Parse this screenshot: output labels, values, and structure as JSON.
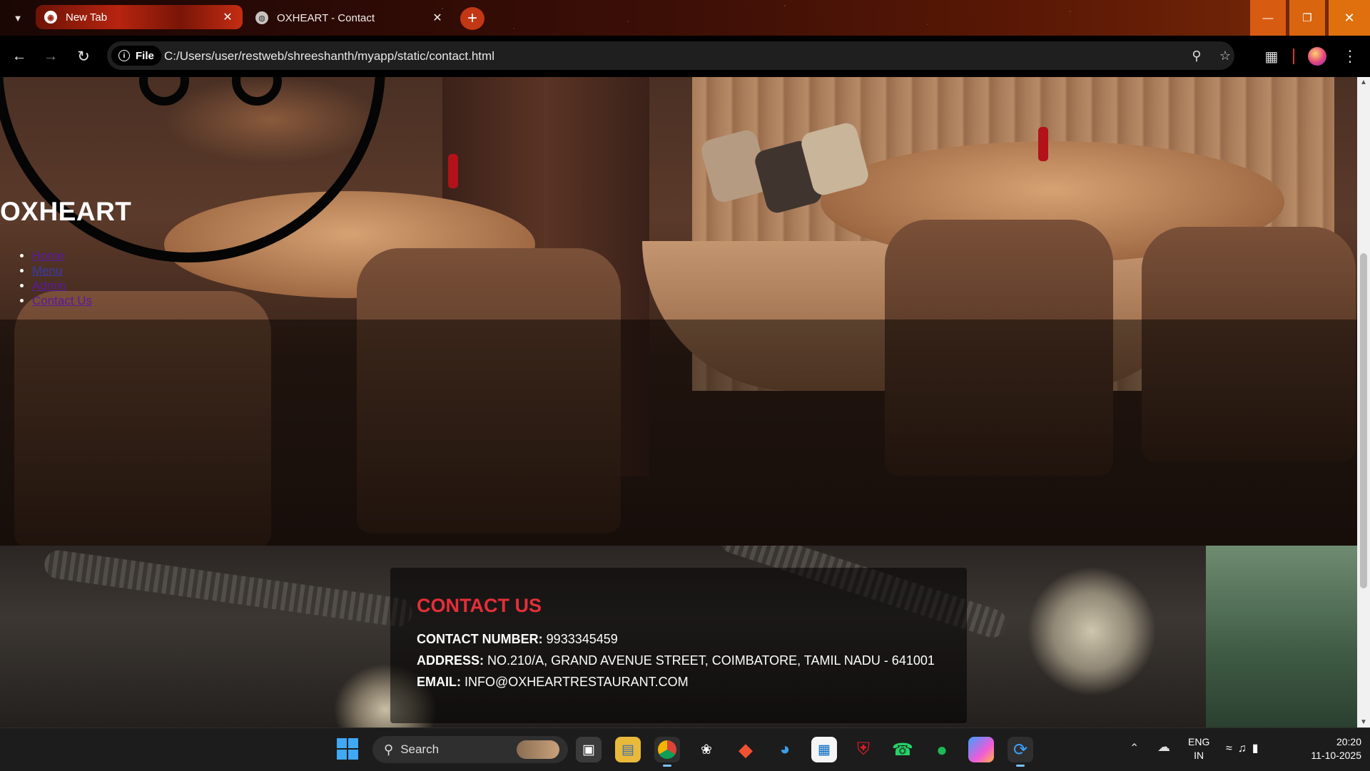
{
  "browser": {
    "tabs": [
      {
        "title": "New Tab",
        "active": false
      },
      {
        "title": "OXHEART - Contact",
        "active": true
      }
    ],
    "address_chip": "File",
    "url": "C:/Users/user/restweb/shreeshanth/myapp/static/contact.html",
    "icons": {
      "tab_list": "chevron-down-icon",
      "new_tab": "plus-icon",
      "back": "arrow-left-icon",
      "forward": "arrow-right-icon",
      "reload": "reload-icon",
      "zoom": "zoom-icon",
      "bookmark": "star-icon",
      "extensions": "puzzle-icon",
      "menu": "kebab-menu-icon"
    },
    "accent_color": "#c23714"
  },
  "page": {
    "brand": "OXHEART",
    "nav": [
      {
        "label": "Home"
      },
      {
        "label": "Menu"
      },
      {
        "label": "Admin"
      },
      {
        "label": "Contact Us"
      }
    ],
    "contact": {
      "heading": "CONTACT US",
      "phone_label": "CONTACT NUMBER:",
      "phone_value": "9933345459",
      "address_label": "ADDRESS:",
      "address_value": "NO.210/A, GRAND AVENUE STREET, COIMBATORE, TAMIL NADU - 641001",
      "email_label": "EMAIL:",
      "email_value": "INFO@OXHEARTRESTAURANT.COM",
      "heading_color": "#e52e3a"
    }
  },
  "taskbar": {
    "search_placeholder": "Search",
    "apps": [
      "task-view",
      "file-explorer",
      "chrome",
      "chatgpt",
      "git",
      "edge",
      "microsoft-store",
      "mcafee",
      "whatsapp",
      "spotify",
      "copilot",
      "vscode"
    ],
    "language": "ENG",
    "region": "IN",
    "time": "20:20",
    "date": "11-10-2025"
  }
}
